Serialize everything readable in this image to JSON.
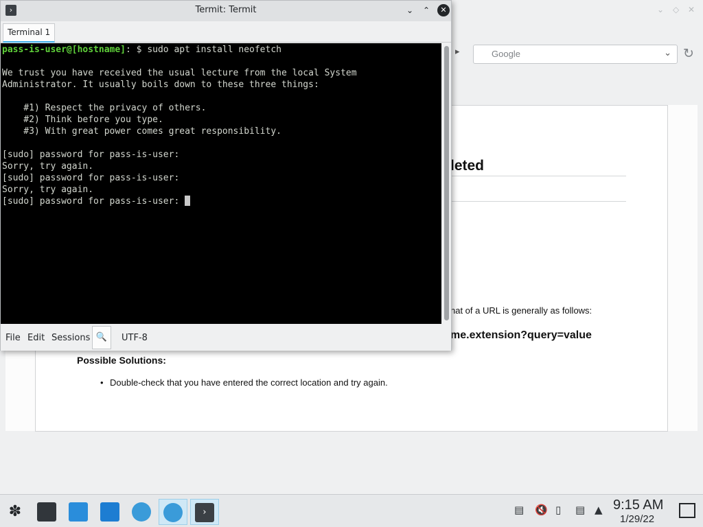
{
  "browser": {
    "search_placeholder": "Google",
    "error_title_fragment": "leted",
    "url_format_text": "nat of a URL is generally as follows:",
    "url_example": "me.extension?query=value",
    "solutions_heading": "Possible Solutions:",
    "solution_item": "Double-check that you have entered the correct location and try again."
  },
  "terminal": {
    "window_title": "Termit: Termit",
    "tab_label": "Terminal 1",
    "prompt_user": "pass-is-user@[hostname]",
    "prompt_rest": ": $ sudo apt install neofetch",
    "lines": [
      "",
      "We trust you have received the usual lecture from the local System",
      "Administrator. It usually boils down to these three things:",
      "",
      "    #1) Respect the privacy of others.",
      "    #2) Think before you type.",
      "    #3) With great power comes great responsibility.",
      "",
      "[sudo] password for pass-is-user:",
      "Sorry, try again.",
      "[sudo] password for pass-is-user:",
      "Sorry, try again."
    ],
    "last_line": "[sudo] password for pass-is-user: ",
    "menu": {
      "file": "File",
      "edit": "Edit",
      "sessions": "Sessions"
    },
    "encoding": "UTF-8"
  },
  "taskbar": {
    "time": "9:15 AM",
    "date": "1/29/22",
    "tasks": [
      "application-launcher-icon",
      "system-settings-icon",
      "discover-store-icon",
      "file-manager-icon",
      "web-browser-icon",
      "web-browser-icon",
      "terminal-icon"
    ],
    "tray": [
      "clipboard-icon",
      "volume-muted-icon",
      "usb-device-icon",
      "network-icon",
      "tray-expand-icon"
    ]
  },
  "colors": {
    "accent": "#3daee9",
    "terminal_bg": "#000000",
    "prompt_green": "#5fd13a"
  }
}
